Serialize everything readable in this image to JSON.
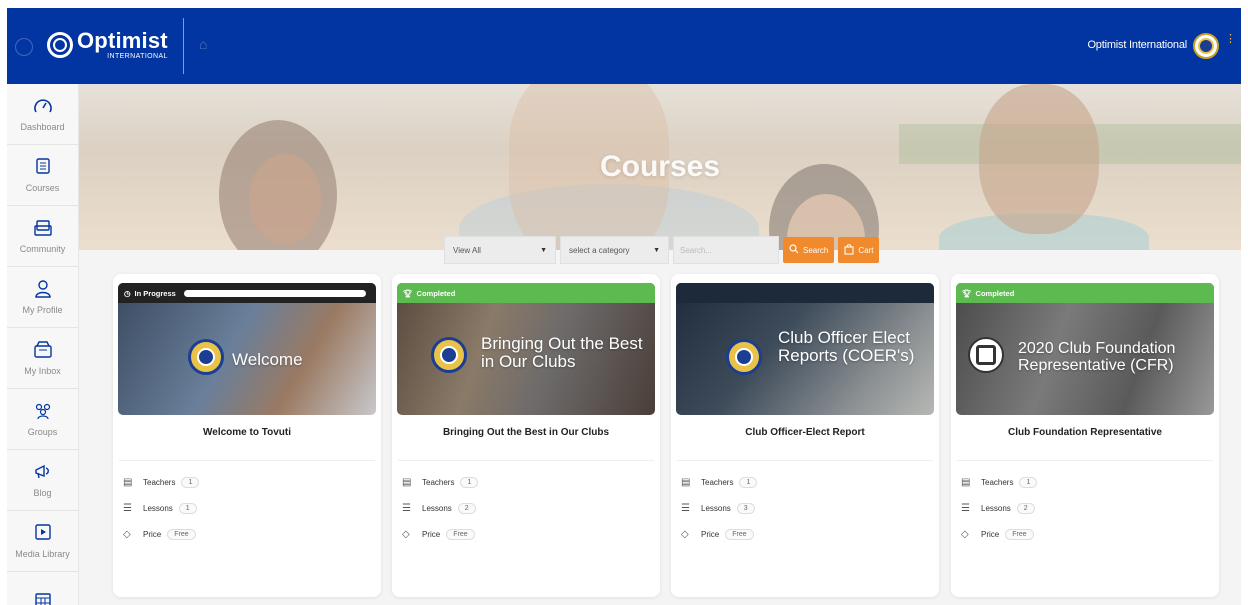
{
  "topbar": {
    "brand": "Optimist",
    "brand_sub": "INTERNATIONAL",
    "user_name": "Optimist International"
  },
  "sidebar": {
    "items": [
      {
        "label": "Dashboard",
        "icon": "gauge-icon"
      },
      {
        "label": "Courses",
        "icon": "courses-icon"
      },
      {
        "label": "Community",
        "icon": "community-icon"
      },
      {
        "label": "My Profile",
        "icon": "profile-icon"
      },
      {
        "label": "My Inbox",
        "icon": "inbox-icon"
      },
      {
        "label": "Groups",
        "icon": "groups-icon"
      },
      {
        "label": "Blog",
        "icon": "megaphone-icon"
      },
      {
        "label": "Media Library",
        "icon": "media-icon"
      },
      {
        "label": "",
        "icon": "calendar-icon"
      }
    ]
  },
  "hero": {
    "title": "Courses"
  },
  "filters": {
    "view_select": "View All",
    "category_select": "select a category",
    "search_placeholder": "Search...",
    "search_button": "Search",
    "cart_button": "Cart"
  },
  "colors": {
    "brand_blue": "#0335a2",
    "accent_orange": "#f08a2c",
    "completed_green": "#5cba51"
  },
  "courses": [
    {
      "status": "In Progress",
      "thumb_text": "Welcome",
      "title": "Welcome to Tovuti",
      "teachers_label": "Teachers",
      "teachers": "1",
      "lessons_label": "Lessons",
      "lessons": "1",
      "price_label": "Price",
      "price": "Free"
    },
    {
      "status": "Completed",
      "thumb_text": "Bringing Out the Best in Our Clubs",
      "title": "Bringing Out the Best in Our Clubs",
      "teachers_label": "Teachers",
      "teachers": "1",
      "lessons_label": "Lessons",
      "lessons": "2",
      "price_label": "Price",
      "price": "Free"
    },
    {
      "status": "",
      "thumb_text": "Club Officer Elect Reports (COER's)",
      "title": "Club Officer-Elect Report",
      "teachers_label": "Teachers",
      "teachers": "1",
      "lessons_label": "Lessons",
      "lessons": "3",
      "price_label": "Price",
      "price": "Free"
    },
    {
      "status": "Completed",
      "thumb_text": "2020 Club Foundation Representative (CFR)",
      "title": "Club Foundation Representative",
      "teachers_label": "Teachers",
      "teachers": "1",
      "lessons_label": "Lessons",
      "lessons": "2",
      "price_label": "Price",
      "price": "Free"
    }
  ]
}
